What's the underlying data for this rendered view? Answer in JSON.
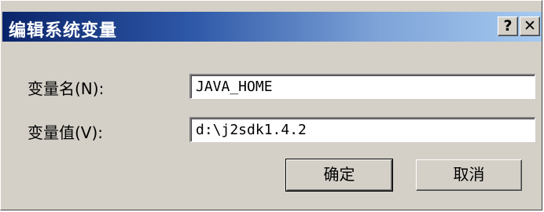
{
  "window": {
    "title": "编辑系统变量",
    "help_label": "?",
    "close_label": "✕"
  },
  "fields": {
    "name_label": "变量名(N):",
    "name_value": "JAVA_HOME",
    "value_label": "变量值(V):",
    "value_value": "d:\\j2sdk1.4.2"
  },
  "buttons": {
    "ok_label": "确定",
    "cancel_label": "取消"
  },
  "colors": {
    "titlebar_start": "#0a246a",
    "titlebar_end": "#a6caf0",
    "face": "#d4d0c8"
  }
}
